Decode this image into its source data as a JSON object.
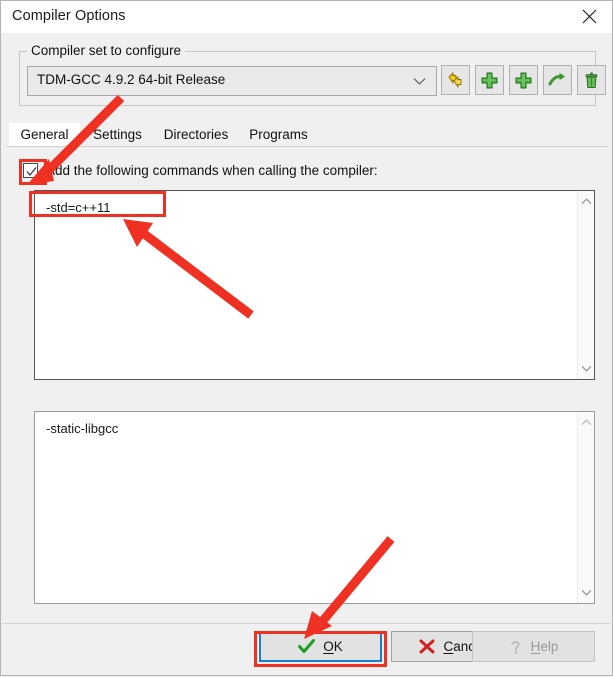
{
  "window": {
    "title": "Compiler Options",
    "close_icon": "close-icon"
  },
  "compiler_group": {
    "legend": "Compiler set to configure",
    "combo": {
      "value": "TDM-GCC 4.9.2 64-bit Release",
      "arrow_icon": "chevron-down-icon"
    },
    "toolbar": [
      {
        "name": "rename-compiler-set-button",
        "icon": "yellow-double-arrow-icon"
      },
      {
        "name": "add-compiler-set-button",
        "icon": "green-plus-icon"
      },
      {
        "name": "duplicate-compiler-set-button",
        "icon": "green-plus-icon"
      },
      {
        "name": "find-compiler-set-button",
        "icon": "green-curved-arrow-icon"
      },
      {
        "name": "delete-compiler-set-button",
        "icon": "green-trash-icon"
      }
    ]
  },
  "tabs": [
    {
      "label": "General",
      "active": true
    },
    {
      "label": "Settings",
      "active": false
    },
    {
      "label": "Directories",
      "active": false
    },
    {
      "label": "Programs",
      "active": false
    }
  ],
  "general_tab": {
    "checkbox": {
      "label": "Add the following commands when calling the compiler:",
      "checked": true
    },
    "commands_textarea": {
      "value": "-std=c++11"
    },
    "linker_textarea": {
      "value": "-static-libgcc"
    },
    "scrollbar": {
      "up_icon": "chevron-up-icon",
      "down_icon": "chevron-down-icon"
    }
  },
  "buttons": {
    "ok": {
      "label": "OK",
      "accel": "O",
      "icon": "green-check-icon",
      "focused": true,
      "disabled": false
    },
    "cancel": {
      "label": "Cancel",
      "accel": "C",
      "icon": "red-x-icon",
      "focused": false,
      "disabled": false
    },
    "help": {
      "label": "Help",
      "accel": "H",
      "icon": "question-mark-icon",
      "focused": false,
      "disabled": true
    }
  },
  "annotations": {
    "accent_color": "#ef3124",
    "highlight_checkbox": "checkbox-highlight",
    "highlight_std_flag": "std-flag-highlight",
    "highlight_ok": "ok-button-highlight",
    "arrow_to_checkbox": "arrow-pointing-to-checkbox",
    "arrow_to_std_flag": "arrow-pointing-to-std-flag",
    "arrow_to_ok": "arrow-pointing-to-ok-button"
  }
}
